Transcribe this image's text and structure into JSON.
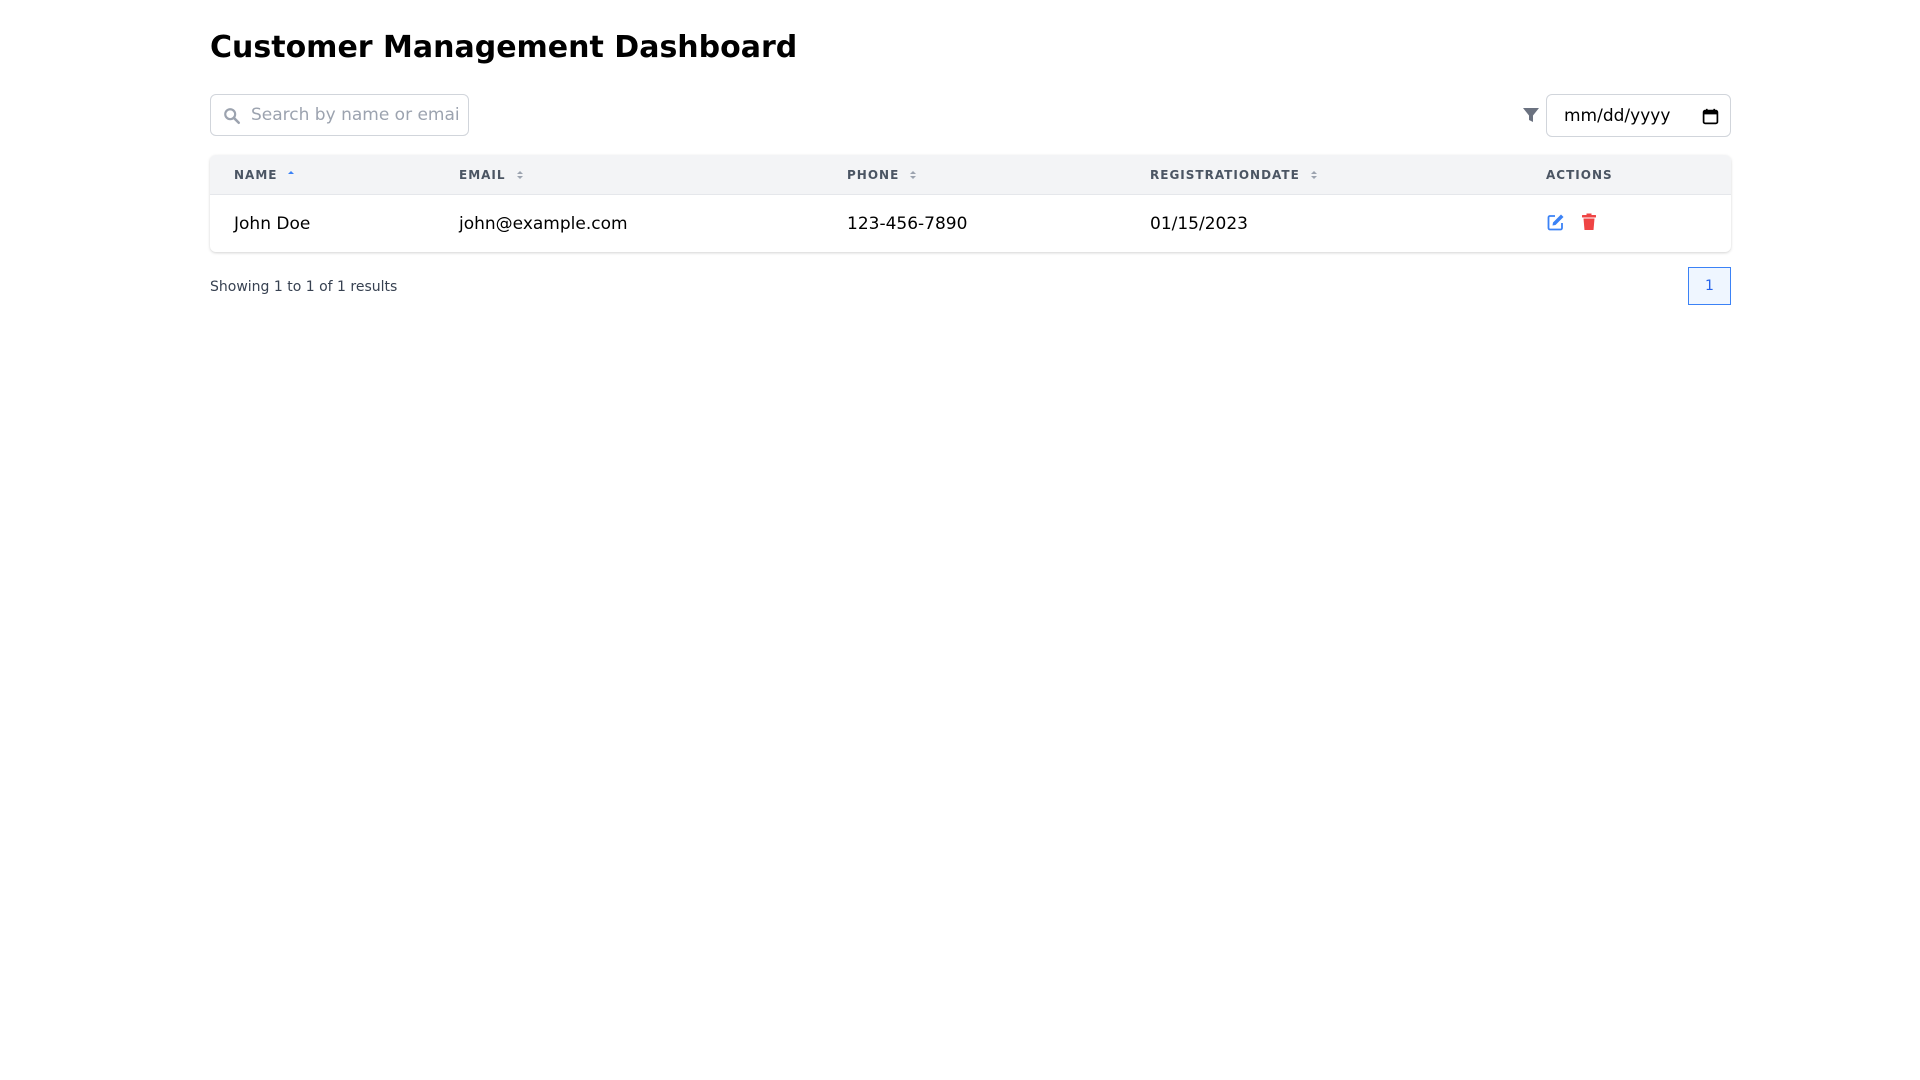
{
  "header": {
    "title": "Customer Management Dashboard"
  },
  "search": {
    "placeholder": "Search by name or email",
    "value": ""
  },
  "filter": {
    "icon": "filter-icon",
    "date_value": "mm/dd/yyyy",
    "calendar_icon": "calendar-icon"
  },
  "table": {
    "columns": [
      {
        "label": "NAME",
        "sort": "ascending"
      },
      {
        "label": "EMAIL",
        "sort": "none"
      },
      {
        "label": "PHONE",
        "sort": "none"
      },
      {
        "label": "REGISTRATIONDATE",
        "sort": "none"
      },
      {
        "label": "ACTIONS",
        "sort": null
      }
    ],
    "rows": [
      {
        "name": "John Doe",
        "email": "john@example.com",
        "phone": "123-456-7890",
        "registration_date": "01/15/2023"
      }
    ]
  },
  "pagination": {
    "summary": "Showing 1 to 1 of 1 results",
    "current_page": "1"
  },
  "colors": {
    "accent": "#3b82f6",
    "danger": "#ef4444",
    "header_bg": "#f3f4f6",
    "muted": "#9ca3af"
  }
}
